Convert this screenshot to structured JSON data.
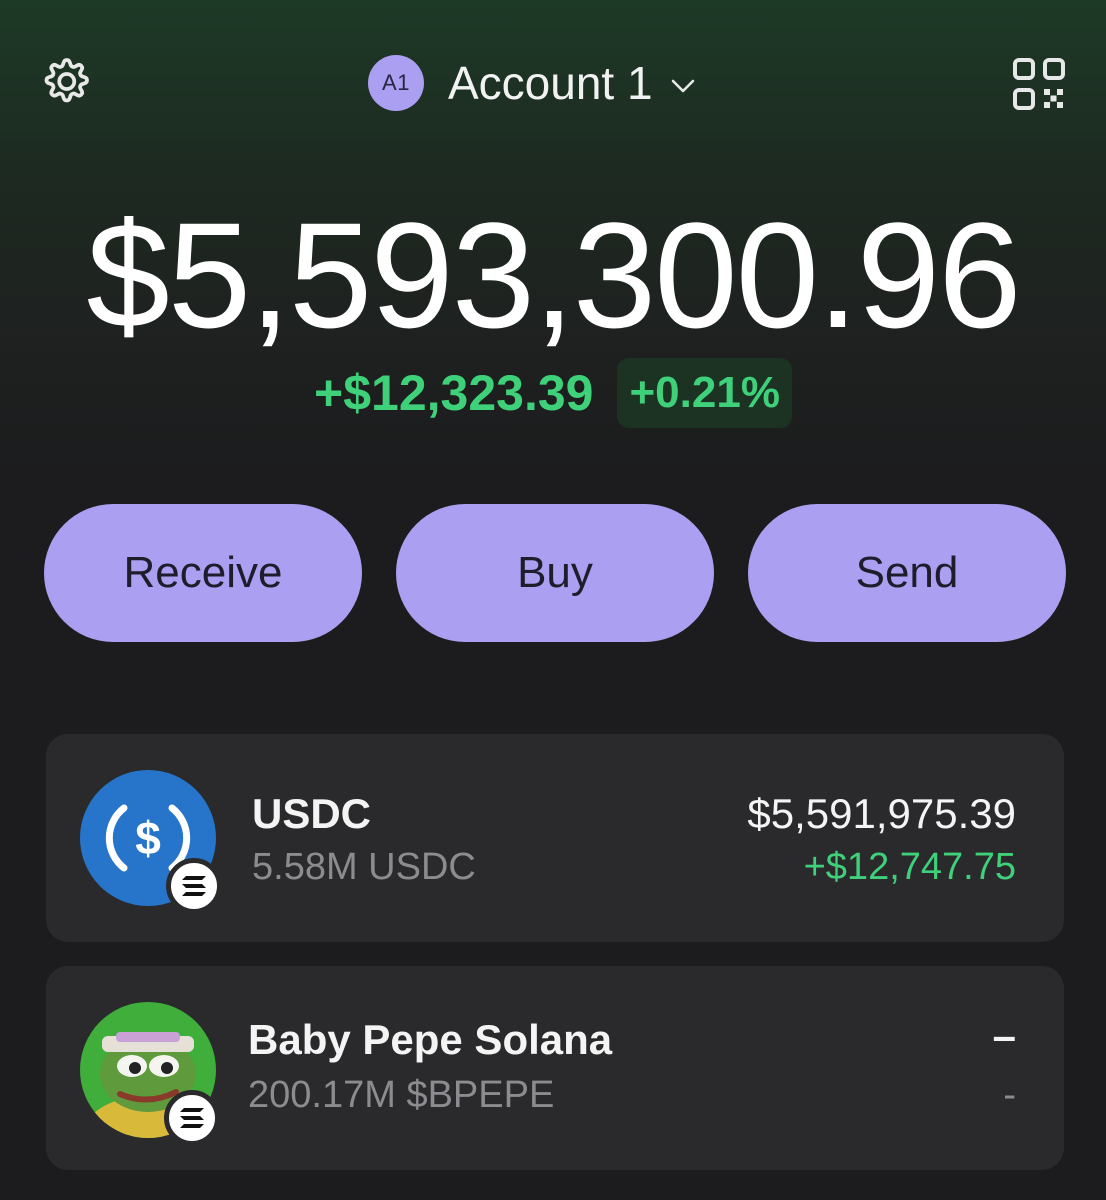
{
  "header": {
    "settings_icon": "gear-icon",
    "account_avatar": "A1",
    "account_name": "Account 1",
    "account_dropdown_icon": "chevron-down-icon",
    "qr_icon": "qr-code-icon"
  },
  "balance": {
    "total": "$5,593,300.96",
    "change_amount": "+$12,323.39",
    "change_percent": "+0.21%"
  },
  "actions": {
    "receive": "Receive",
    "buy": "Buy",
    "send": "Send"
  },
  "tokens": [
    {
      "name": "USDC",
      "amount": "5.58M USDC",
      "value": "$5,591,975.39",
      "change": "+$12,747.75",
      "icon": "usdc-logo-icon",
      "chain_icon": "solana-icon"
    },
    {
      "name": "Baby Pepe Solana",
      "amount": "200.17M $BPEPE",
      "value": "–",
      "change": "-",
      "icon": "baby-pepe-logo-icon",
      "chain_icon": "solana-icon"
    }
  ],
  "colors": {
    "accent": "#ab9ff2",
    "positive": "#3fd07a",
    "card_bg": "#2a2a2d",
    "usdc_blue": "#2775ca"
  }
}
